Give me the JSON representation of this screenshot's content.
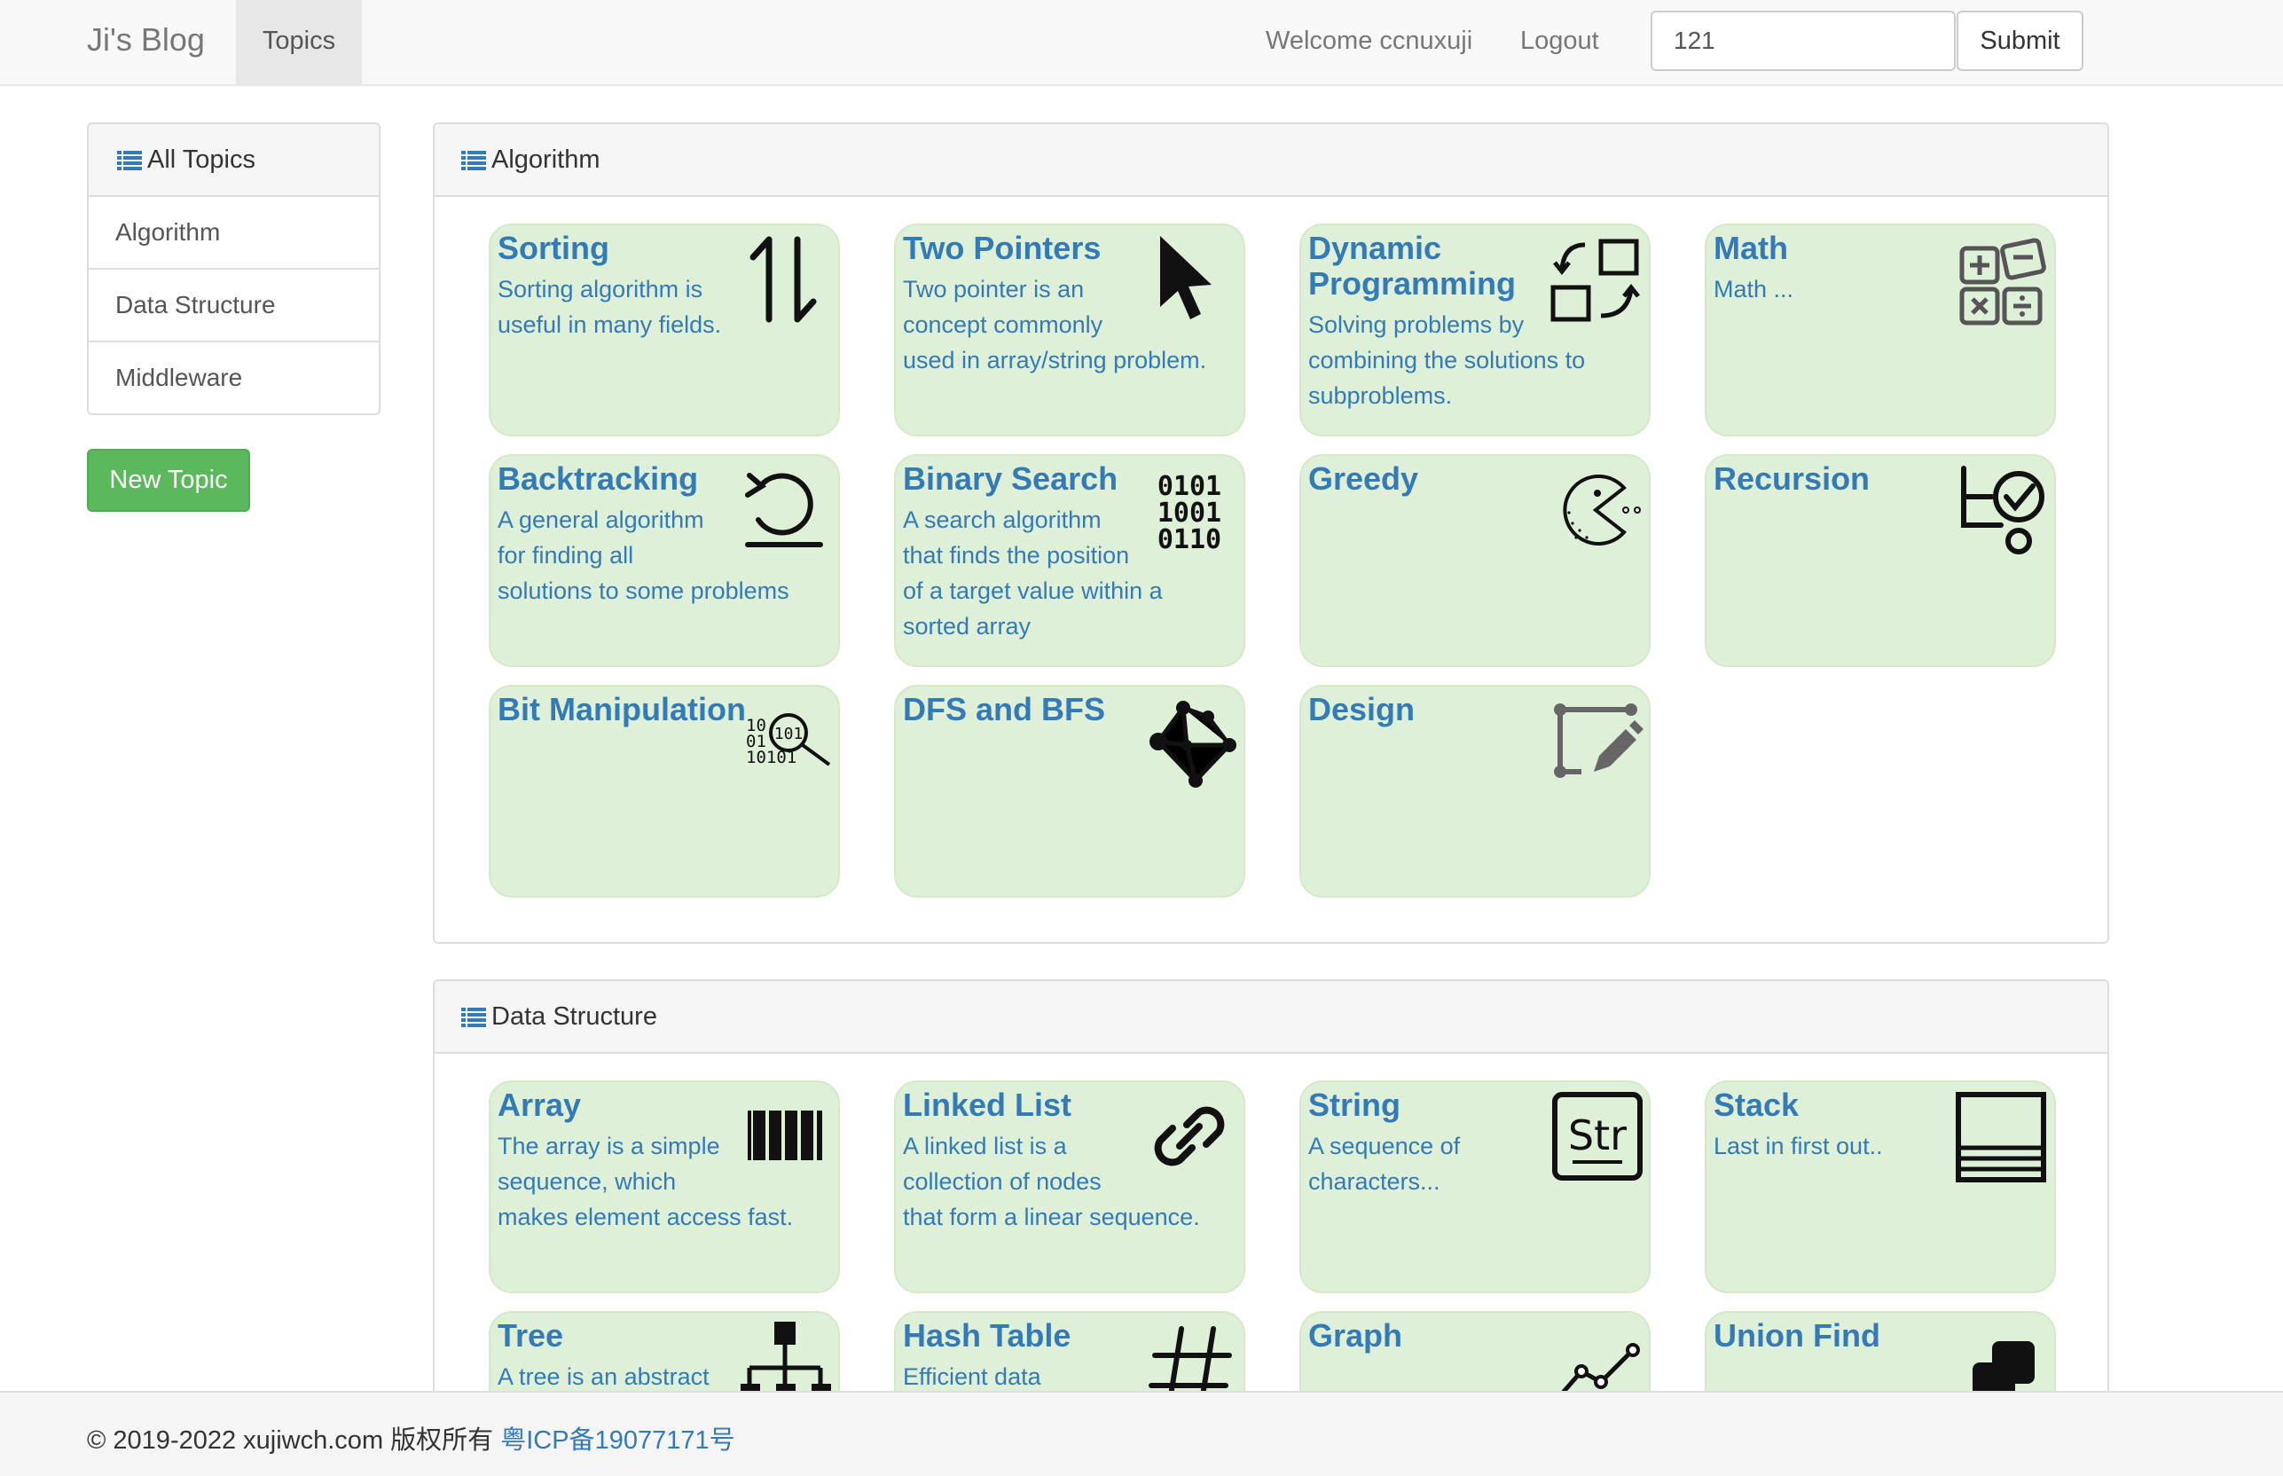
{
  "navbar": {
    "brand": "Ji's Blog",
    "topics_label": "Topics",
    "welcome": "Welcome ccnuxuji",
    "logout": "Logout",
    "search_value": "121",
    "submit_label": "Submit"
  },
  "sidebar": {
    "heading": "All Topics",
    "items": [
      {
        "label": "Algorithm"
      },
      {
        "label": "Data Structure"
      },
      {
        "label": "Middleware"
      }
    ],
    "new_topic_label": "New Topic"
  },
  "sections": [
    {
      "heading": "Algorithm",
      "cards": [
        {
          "title": "Sorting",
          "desc": [
            "Sorting algorithm is",
            "useful in many fields."
          ],
          "icon": "sort-arrows-icon"
        },
        {
          "title": "Two Pointers",
          "desc": [
            "Two pointer is an",
            "concept commonly",
            "used in array/string problem."
          ],
          "icon": "cursor-pointer-icon"
        },
        {
          "title": "Dynamic Programming",
          "desc": [
            "Solving problems by",
            "combining the solutions to",
            "subproblems."
          ],
          "icon": "squares-cycle-icon"
        },
        {
          "title": "Math",
          "desc": [
            "Math ..."
          ],
          "icon": "calculator-icon"
        },
        {
          "title": "Backtracking",
          "desc": [
            "A general algorithm",
            "for finding all",
            "solutions to some problems"
          ],
          "icon": "undo-icon"
        },
        {
          "title": "Binary Search",
          "desc": [
            "A search algorithm",
            "that finds the position",
            "of a target value within a",
            "sorted array"
          ],
          "icon": "binary-digits-icon"
        },
        {
          "title": "Greedy",
          "desc": [],
          "icon": "pacman-icon"
        },
        {
          "title": "Recursion",
          "desc": [],
          "icon": "flow-check-icon"
        },
        {
          "title": "Bit Manipulation",
          "desc": [],
          "icon": "binary-magnifier-icon"
        },
        {
          "title": "DFS and BFS",
          "desc": [],
          "icon": "graph-nodes-icon"
        },
        {
          "title": "Design",
          "desc": [],
          "icon": "draw-pencil-icon"
        }
      ]
    },
    {
      "heading": "Data Structure",
      "cards": [
        {
          "title": "Array",
          "desc": [
            "The array is a simple",
            "sequence, which",
            "makes element access fast."
          ],
          "icon": "array-bars-icon"
        },
        {
          "title": "Linked List",
          "desc": [
            "A linked list is a",
            "collection of nodes",
            "that form a linear sequence."
          ],
          "icon": "chain-link-icon"
        },
        {
          "title": "String",
          "desc": [
            "A sequence of",
            "characters..."
          ],
          "icon": "string-box-icon",
          "icon_text": "Str"
        },
        {
          "title": "Stack",
          "desc": [
            "Last in first out.."
          ],
          "icon": "stack-lines-icon"
        },
        {
          "title": "Tree",
          "desc": [
            "A tree is an abstract"
          ],
          "icon": "org-tree-icon"
        },
        {
          "title": "Hash Table",
          "desc": [
            "Efficient data"
          ],
          "icon": "hash-icon"
        },
        {
          "title": "Graph",
          "desc": [],
          "icon": "line-graph-icon"
        },
        {
          "title": "Union Find",
          "desc": [],
          "icon": "union-squares-icon"
        }
      ]
    }
  ],
  "footer": {
    "copyright": "© 2019-2022 xujiwch.com 版权所有",
    "icp": "粤ICP备19077171号"
  },
  "colors": {
    "card_bg": "#dff0d8",
    "link": "#337ab7",
    "success": "#5cb85c"
  }
}
